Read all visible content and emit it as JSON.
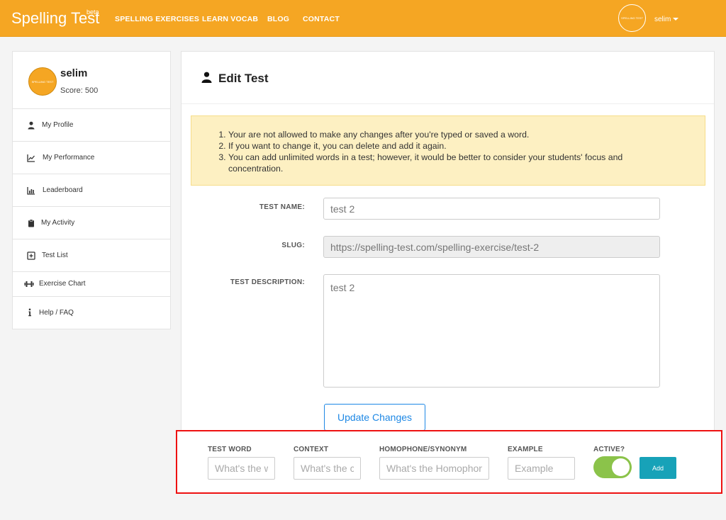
{
  "navbar": {
    "brand": "Spelling Test",
    "brand_sup": "beta",
    "links": [
      "SPELLING EXERCISES",
      "LEARN VOCAB",
      "BLOG",
      "CONTACT"
    ],
    "avatar_text": "SPELLING TEST",
    "username": "selim"
  },
  "sidebar": {
    "profile": {
      "name": "selim",
      "score": "Score: 500",
      "avatar_text": "SPELLING TEST"
    },
    "items": [
      {
        "label": "My Profile",
        "icon": "user-icon"
      },
      {
        "label": "My Performance",
        "icon": "line-chart-icon"
      },
      {
        "label": "Leaderboard",
        "icon": "bar-chart-icon"
      },
      {
        "label": "My Activity",
        "icon": "clipboard-icon"
      },
      {
        "label": "Test List",
        "icon": "plus-square-icon"
      },
      {
        "label": "Exercise Chart",
        "icon": "dumbbell-icon"
      },
      {
        "label": "Help / FAQ",
        "icon": "info-icon"
      }
    ]
  },
  "main": {
    "title": "Edit Test",
    "notes": [
      "Your are not allowed to make any changes after you're typed or saved a word.",
      "If you want to change it, you can delete and add it again.",
      "You can add unlimited words in a test; however, it would be better to consider your students' focus and concentration."
    ],
    "form": {
      "test_name_label": "TEST NAME:",
      "test_name_value": "test 2",
      "slug_label": "SLUG:",
      "slug_value": "https://spelling-test.com/spelling-exercise/test-2",
      "description_label": "TEST DESCRIPTION:",
      "description_value": "test 2",
      "update_button": "Update Changes"
    },
    "word_form": {
      "test_word_label": "TEST WORD",
      "test_word_placeholder": "What's the word?",
      "context_label": "CONTEXT",
      "context_placeholder": "What's the context?",
      "homophone_label": "HOMOPHONE/SYNONYM",
      "homophone_placeholder": "What's the Homophone?",
      "example_label": "EXAMPLE",
      "example_placeholder": "Example",
      "active_label": "ACTIVE?",
      "active": true,
      "add_button": "Add"
    }
  },
  "colors": {
    "brand": "#f5a623",
    "toggle_on": "#8bc34a",
    "add_button": "#17a2b8",
    "update_button": "#1e88e5",
    "highlight_border": "#ee1111"
  }
}
